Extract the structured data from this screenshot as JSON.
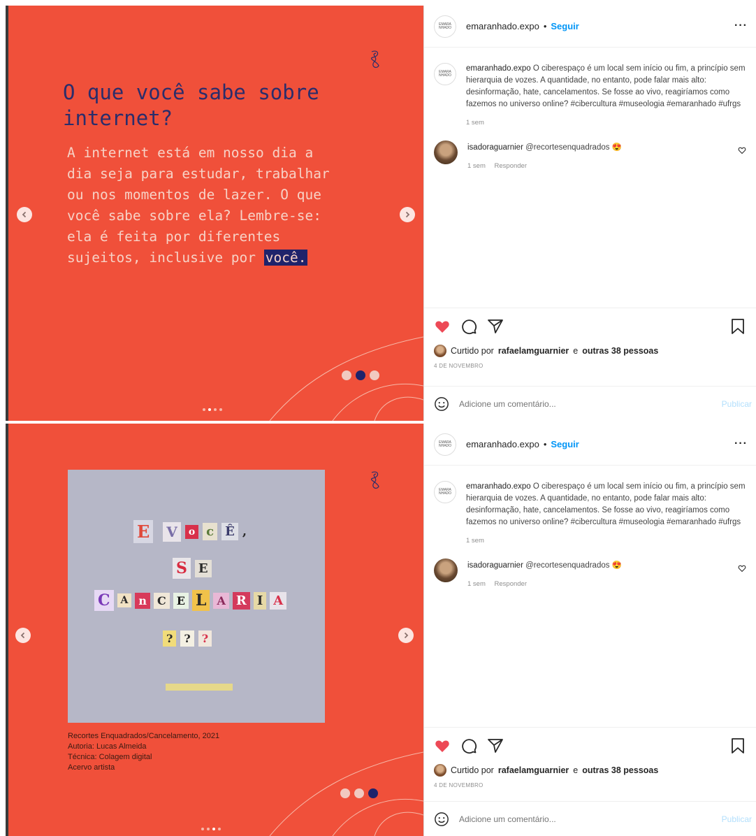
{
  "posts": [
    {
      "slide": {
        "title": "O que você sabe sobre internet?",
        "body": "A internet está em nosso dia a dia seja para estudar, trabalhar ou nos momentos de lazer. O que você sabe sobre ela? Lembre-se: ela é feita por diferentes sujeitos, inclusive por",
        "highlight": "você.",
        "active_slide": 2,
        "slide_count": 3
      },
      "header": {
        "username": "emaranhado.expo",
        "separator": "•",
        "follow": "Seguir",
        "more": "···",
        "avatar_text": "EMARA NHADO"
      },
      "caption": {
        "username": "emaranhado.expo",
        "text": "O ciberespaço é um local sem início ou fim, a princípio sem hierarquia de vozes. A quantidade, no entanto, pode falar mais alto: desinformação, hate, cancelamentos. Se fosse ao vivo, reagiríamos como fazemos no universo online? #cibercultura #museologia #emaranhado #ufrgs",
        "time": "1 sem"
      },
      "comment": {
        "username": "isadoraguarnier",
        "text": "@recortesenquadrados 😍",
        "time": "1 sem",
        "reply": "Responder"
      },
      "likes": {
        "prefix": "Curtido por",
        "user": "rafaelamguarnier",
        "middle": "e",
        "others": "outras 38 pessoas"
      },
      "date": "4 DE NOVEMBRO",
      "add_comment_placeholder": "Adicione um comentário...",
      "publish": "Publicar"
    },
    {
      "slide": {
        "art_lines": [
          [
            "E",
            "V",
            "o",
            "c",
            "Ê",
            ","
          ],
          [
            "S",
            "E"
          ],
          [
            "C",
            "A",
            "n",
            "C",
            "E",
            "L",
            "A",
            "R",
            "I",
            "A"
          ],
          [
            "?",
            "?",
            "?"
          ]
        ],
        "credit": [
          "Recortes Enquadrados/Cancelamento, 2021",
          "Autoria: Lucas Almeida",
          "Técnica: Colagem digital",
          "Acervo artista"
        ],
        "active_slide": 3,
        "slide_count": 3
      },
      "header": {
        "username": "emaranhado.expo",
        "separator": "•",
        "follow": "Seguir",
        "more": "···",
        "avatar_text": "EMARA NHADO"
      },
      "caption": {
        "username": "emaranhado.expo",
        "text": "O ciberespaço é um local sem início ou fim, a princípio sem hierarquia de vozes. A quantidade, no entanto, pode falar mais alto: desinformação, hate, cancelamentos. Se fosse ao vivo, reagiríamos como fazemos no universo online? #cibercultura #museologia #emaranhado #ufrgs",
        "time": "1 sem"
      },
      "comment": {
        "username": "isadoraguarnier",
        "text": "@recortesenquadrados 😍",
        "time": "1 sem",
        "reply": "Responder"
      },
      "likes": {
        "prefix": "Curtido por",
        "user": "rafaelamguarnier",
        "middle": "e",
        "others": "outras 38 pessoas"
      },
      "date": "4 DE NOVEMBRO",
      "add_comment_placeholder": "Adicione um comentário...",
      "publish": "Publicar"
    }
  ],
  "colors": {
    "slide_bg": "#f0503a",
    "navy": "#1f236b",
    "like_red": "#ed4956",
    "link_blue": "#0095f6"
  }
}
